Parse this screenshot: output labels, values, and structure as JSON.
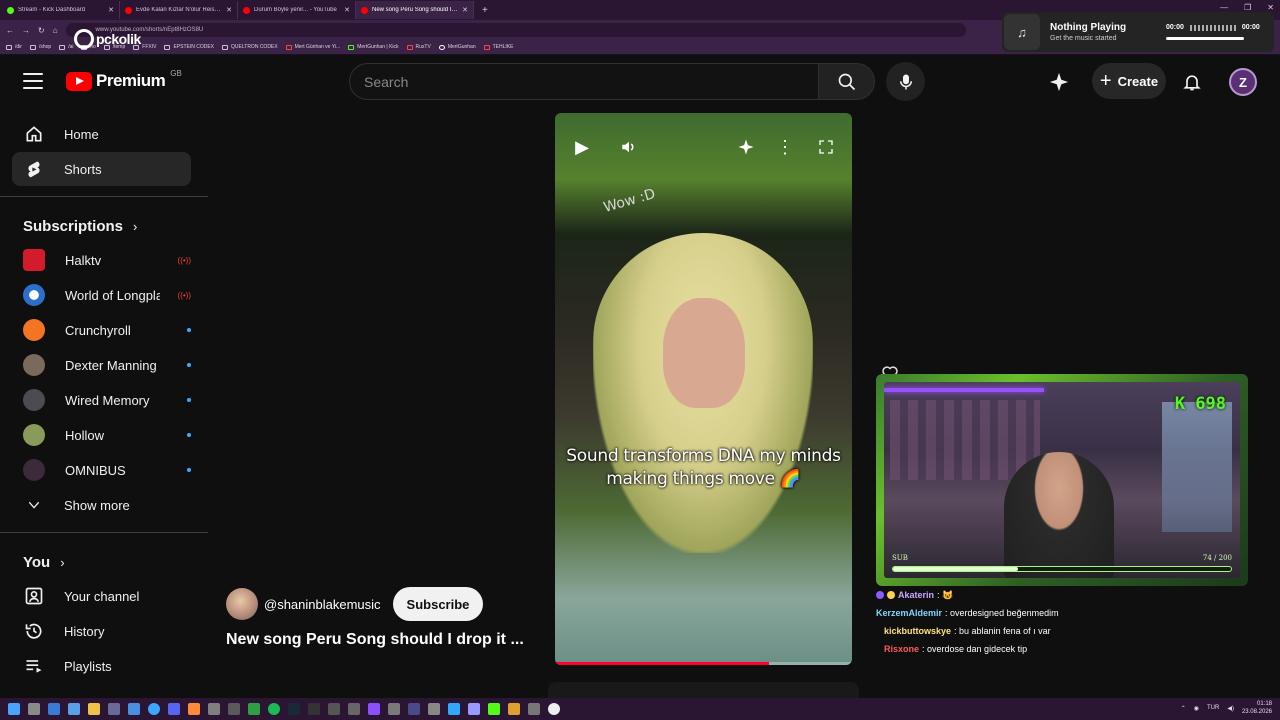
{
  "browser": {
    "tabs": [
      {
        "title": "Stream - Kick Dashboard",
        "color": "#53fc18",
        "active": false
      },
      {
        "title": "Evde Kalan Kızlar N'olur Reis parç...",
        "color": "#ff0000",
        "active": false
      },
      {
        "title": "Durum Böyle yenir... - YouTube",
        "color": "#ff0000",
        "active": false
      },
      {
        "title": "New song Peru Song should I dro...",
        "color": "#ff0000",
        "active": true
      }
    ],
    "url": "www.youtube.com/shorts/nEpt8HzOS8U",
    "bookmarks": [
      "/dir",
      "/shop",
      "/ai",
      "/io",
      "/temp",
      "FFXIV",
      "EPSTEIN CODEX",
      "QUELTRON CODEX",
      "Mert Günhan ve Yi...",
      "MertGunhan | Kick",
      "RusTV",
      "MertGunhan",
      "TEHLIKE"
    ],
    "overlay_logo": "pckolik"
  },
  "music_widget": {
    "title": "Nothing Playing",
    "subtitle": "Get the music started",
    "time_start": "00:00",
    "time_end": "00:00"
  },
  "header": {
    "logo_text": "Premium",
    "country_code": "GB",
    "search_placeholder": "Search",
    "create_label": "Create",
    "avatar_letter": "Z"
  },
  "sidebar": {
    "main": [
      {
        "label": "Home",
        "icon": "home-icon"
      },
      {
        "label": "Shorts",
        "icon": "shorts-icon",
        "active": true
      }
    ],
    "subscriptions_title": "Subscriptions",
    "subscriptions": [
      {
        "name": "Halktv",
        "status": "live",
        "color": "#d41b2c"
      },
      {
        "name": "World of Longpla...",
        "status": "live",
        "color": "#2a6fc9"
      },
      {
        "name": "Crunchyroll",
        "status": "new",
        "color": "#f47521"
      },
      {
        "name": "Dexter Manning",
        "status": "new",
        "color": "#7a6a5c"
      },
      {
        "name": "Wired Memory",
        "status": "new",
        "color": "#4d4a52"
      },
      {
        "name": "Hollow",
        "status": "new",
        "color": "#8a9a5a"
      },
      {
        "name": "OMNIBUS",
        "status": "new",
        "color": "#3a2a3a"
      }
    ],
    "show_more": "Show more",
    "you_title": "You",
    "you_items": [
      {
        "label": "Your channel",
        "icon": "your-channel-icon"
      },
      {
        "label": "History",
        "icon": "history-icon"
      },
      {
        "label": "Playlists",
        "icon": "playlists-icon"
      }
    ]
  },
  "short": {
    "overlay_text": "Wow :D",
    "caption": "Sound transforms DNA my minds making things move",
    "caption_emoji": "🌈",
    "channel_handle": "@shaninblakemusic",
    "subscribe_label": "Subscribe",
    "title": "New song Peru Song should I drop it ...",
    "progress": 0.72
  },
  "stream_overlay": {
    "kick_count": "K 698",
    "sub_label": "SUB",
    "sub_count": "74 / 200",
    "sub_progress": 0.37
  },
  "chat": [
    {
      "user": "Akaterin",
      "message": ": 😺",
      "color": "#c8a6ff"
    },
    {
      "user": "KerzemAldemir",
      "message": ": overdesigned beğenmedim",
      "color": "#7fd6ff"
    },
    {
      "user": "kickbuttowskye",
      "message": ": bu ablanin fena of ı var",
      "color": "#ffe17f"
    },
    {
      "user": "Risxone",
      "message": ": overdose dan gidecek tip",
      "color": "#ff5a5a"
    }
  ],
  "taskbar": {
    "language": "TUR",
    "time": "01:18",
    "date": "23.08.2026"
  }
}
